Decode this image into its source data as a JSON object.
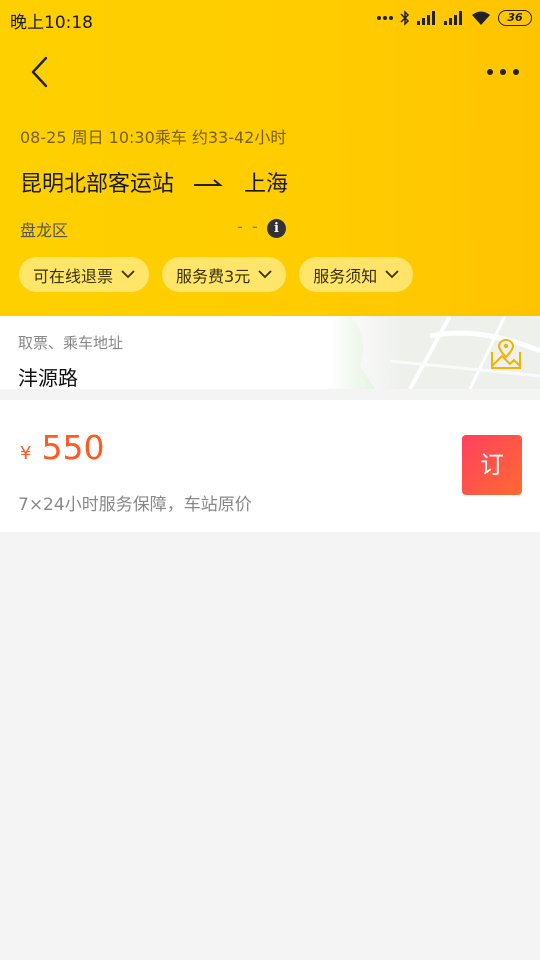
{
  "status_bar": {
    "time": "晚上10:18",
    "battery": "36"
  },
  "trip": {
    "meta": "08-25 周日 10:30乘车 约33-42小时",
    "from": "昆明北部客运站",
    "to": "上海",
    "from_district": "盘龙区",
    "to_district": "- -"
  },
  "chips": [
    {
      "label": "可在线退票"
    },
    {
      "label": "服务费3元"
    },
    {
      "label": "服务须知"
    }
  ],
  "address": {
    "label": "取票、乘车地址",
    "value": "沣源路"
  },
  "offer": {
    "currency": "¥",
    "price": "550",
    "guarantee": "7×24小时服务保障，车站原价",
    "book_label": "订"
  },
  "colors": {
    "accent": "#ffcc00",
    "price": "#ff5a1f"
  },
  "icons": [
    "back-arrow-icon",
    "more-icon",
    "info-icon",
    "chevron-down-icon",
    "map-pin-icon"
  ]
}
